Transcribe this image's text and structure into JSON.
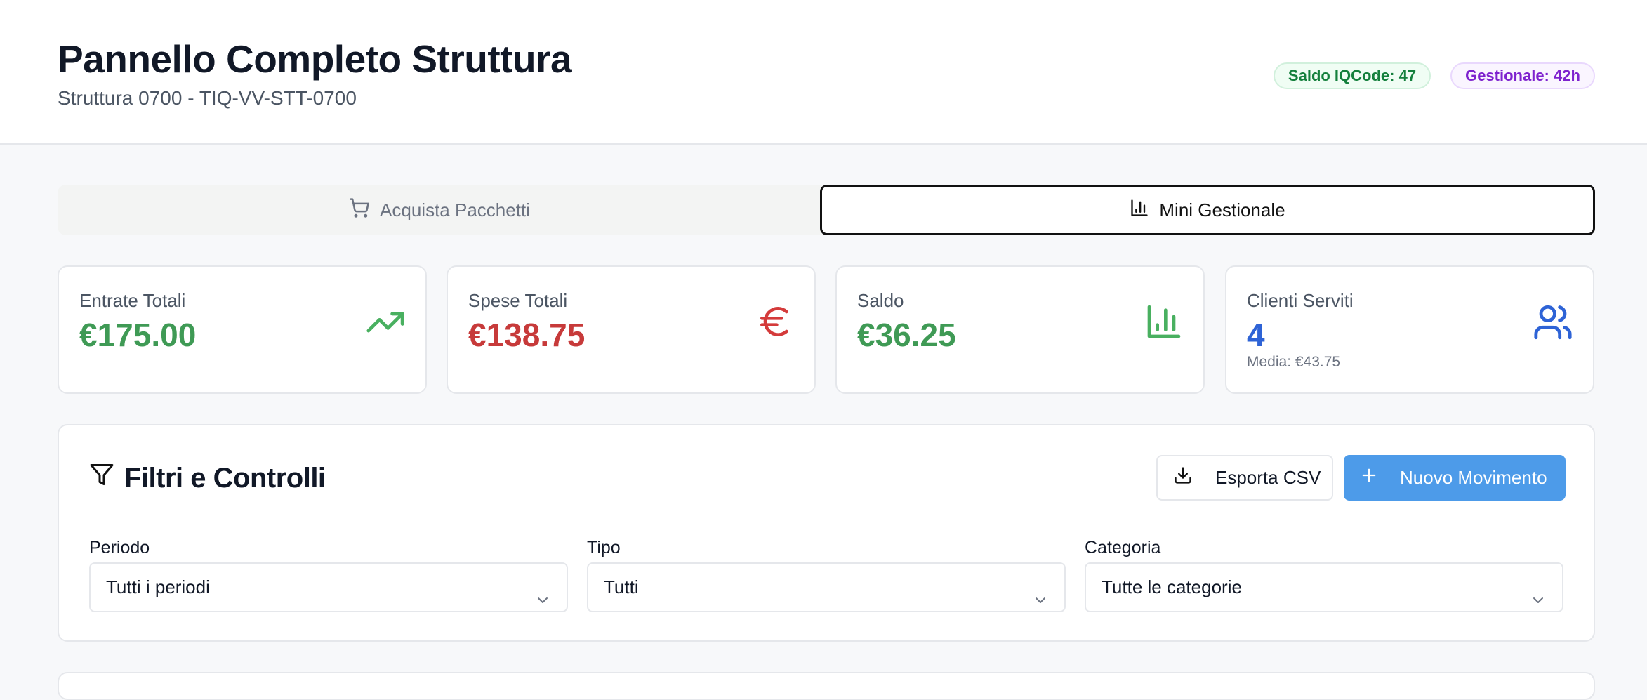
{
  "header": {
    "title": "Pannello Completo Struttura",
    "subtitle": "Struttura 0700 - TIQ-VV-STT-0700",
    "badge_saldo": "Saldo IQCode: 47",
    "badge_gestionale": "Gestionale: 42h"
  },
  "tabs": [
    {
      "label": "Acquista Pacchetti",
      "icon": "cart-icon",
      "active": false
    },
    {
      "label": "Mini Gestionale",
      "icon": "bar-chart-icon",
      "active": true
    }
  ],
  "stats": [
    {
      "label": "Entrate Totali",
      "value": "€175.00",
      "color": "#3f9a55",
      "icon": "trending-up-icon"
    },
    {
      "label": "Spese Totali",
      "value": "€138.75",
      "color": "#c73a3a",
      "icon": "euro-icon"
    },
    {
      "label": "Saldo",
      "value": "€36.25",
      "color": "#3f9a55",
      "icon": "bar-chart-icon"
    },
    {
      "label": "Clienti Serviti",
      "value": "4",
      "sub": "Media: €43.75",
      "color": "#2e63d6",
      "icon": "users-icon"
    }
  ],
  "filters": {
    "title": "Filtri e Controlli",
    "export_label": "Esporta CSV",
    "new_label": "Nuovo Movimento",
    "fields": [
      {
        "label": "Periodo",
        "value": "Tutti i periodi"
      },
      {
        "label": "Tipo",
        "value": "Tutti"
      },
      {
        "label": "Categoria",
        "value": "Tutte le categorie"
      }
    ]
  },
  "colors": {
    "accent_blue": "#4d9be9",
    "green": "#3f9a55",
    "red": "#c73a3a",
    "purple": "#7e22ce"
  }
}
